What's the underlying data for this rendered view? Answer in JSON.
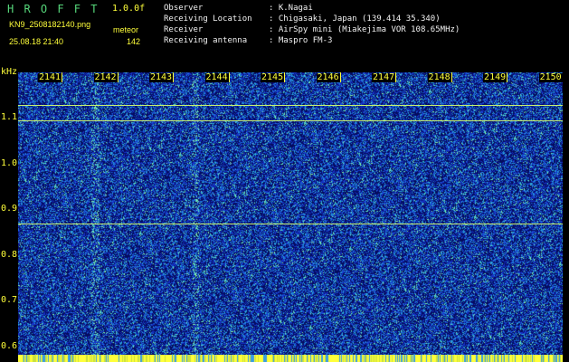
{
  "header": {
    "app_name": "H R O F F T",
    "version": "1.0.0f",
    "filename": "KN9_2508182140.png",
    "datetime": "25.08.18 21:40",
    "meteor_label": "meteor",
    "meteor_count": "142",
    "info": [
      {
        "label": "Observer",
        "value": ": K.Nagai"
      },
      {
        "label": "Receiving Location",
        "value": ": Chigasaki, Japan (139.414 35.340)"
      },
      {
        "label": "Receiver",
        "value": ": AirSpy mini (Miakejima VOR 108.65MHz)"
      },
      {
        "label": "Receiving antenna",
        "value": ": Maspro FM-3"
      }
    ]
  },
  "chart_data": {
    "type": "heatmap",
    "ylabel": "kHz",
    "x_ticks": [
      "2141",
      "2142",
      "2143",
      "2144",
      "2145",
      "2146",
      "2147",
      "2148",
      "2149",
      "2150"
    ],
    "y_ticks": [
      "1.1",
      "1.0",
      "0.9",
      "0.8",
      "0.7",
      "0.6"
    ],
    "y_tick_values": [
      1.1,
      1.0,
      0.9,
      0.8,
      0.7,
      0.6
    ],
    "ylim": [
      0.58,
      1.2
    ],
    "horizontal_lines_khz": [
      1.128,
      1.095,
      0.87
    ],
    "colors": {
      "background": "#050a55",
      "noise_low": "#1a3bd0",
      "noise_mid": "#2aa6d8",
      "noise_high": "#7cf0b0",
      "line": "#c8f070",
      "accent": "#ffff3a"
    }
  }
}
